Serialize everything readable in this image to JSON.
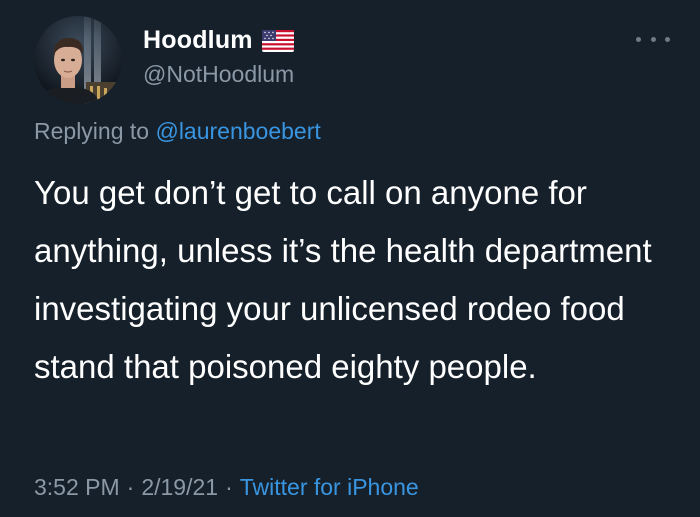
{
  "tweet": {
    "author": {
      "display_name": "Hoodlum",
      "handle": "@NotHoodlum",
      "avatar": "profile-photo",
      "flag": "us-flag-emoji"
    },
    "more_icon": "more-horizontal-icon",
    "reply": {
      "prefix": "Replying to",
      "to_handle": "@laurenboebert"
    },
    "text": "You get don’t get to call on anyone for anything, unless it’s the health department investigating your unlicensed rodeo food stand that poisoned eighty people.",
    "meta": {
      "time": "3:52 PM",
      "date": "2/19/21",
      "separator": "·",
      "source": "Twitter for iPhone"
    }
  },
  "colors": {
    "background": "#15202b",
    "text_primary": "#ffffff",
    "text_secondary": "#8b98a5",
    "link": "#3a95e0"
  }
}
